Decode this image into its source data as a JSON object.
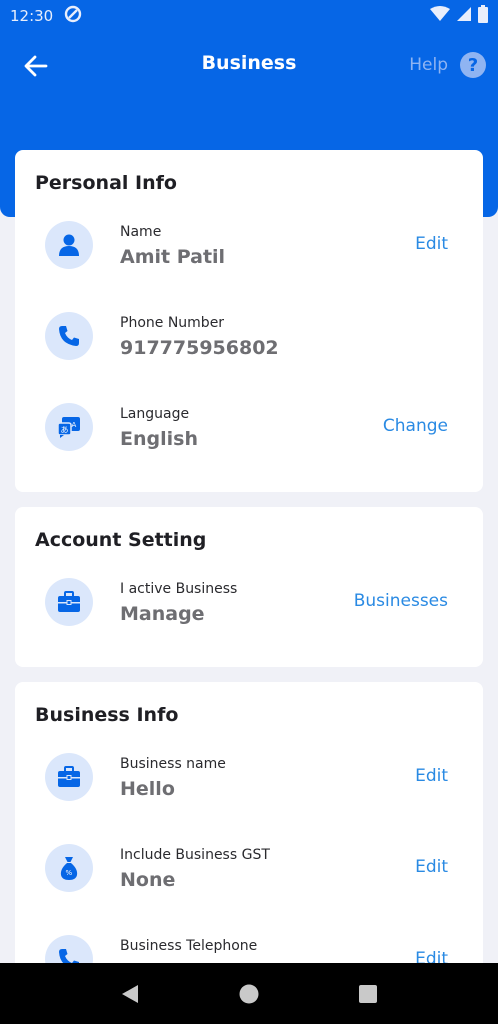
{
  "status_bar": {
    "time": "12:30"
  },
  "app_bar": {
    "title": "Business",
    "help_label": "Help",
    "help_icon_glyph": "?"
  },
  "personal_info": {
    "title": "Personal Info",
    "rows": [
      {
        "label": "Name",
        "value": "Amit Patil",
        "action": "Edit",
        "icon": "person-icon"
      },
      {
        "label": "Phone Number",
        "value": "917775956802",
        "icon": "phone-icon"
      },
      {
        "label": "Language",
        "value": "English",
        "action": "Change",
        "icon": "translate-icon"
      }
    ]
  },
  "account_setting": {
    "title": "Account Setting",
    "rows": [
      {
        "label": "I active Business",
        "value": "Manage",
        "action": "Businesses",
        "icon": "briefcase-icon"
      }
    ]
  },
  "business_info": {
    "title": "Business Info",
    "rows": [
      {
        "label": "Business name",
        "value": "Hello",
        "action": "Edit",
        "icon": "briefcase-icon"
      },
      {
        "label": "Include Business GST",
        "value": "None",
        "action": "Edit",
        "icon": "money-bag-icon"
      },
      {
        "label": "Business Telephone",
        "action": "Edit",
        "icon": "phone-icon"
      }
    ]
  },
  "colors": {
    "primary": "#0666e6",
    "accent_link": "#2a8ae3",
    "icon_bg": "#dbe7fb",
    "page_bg": "#f0f1f7"
  }
}
